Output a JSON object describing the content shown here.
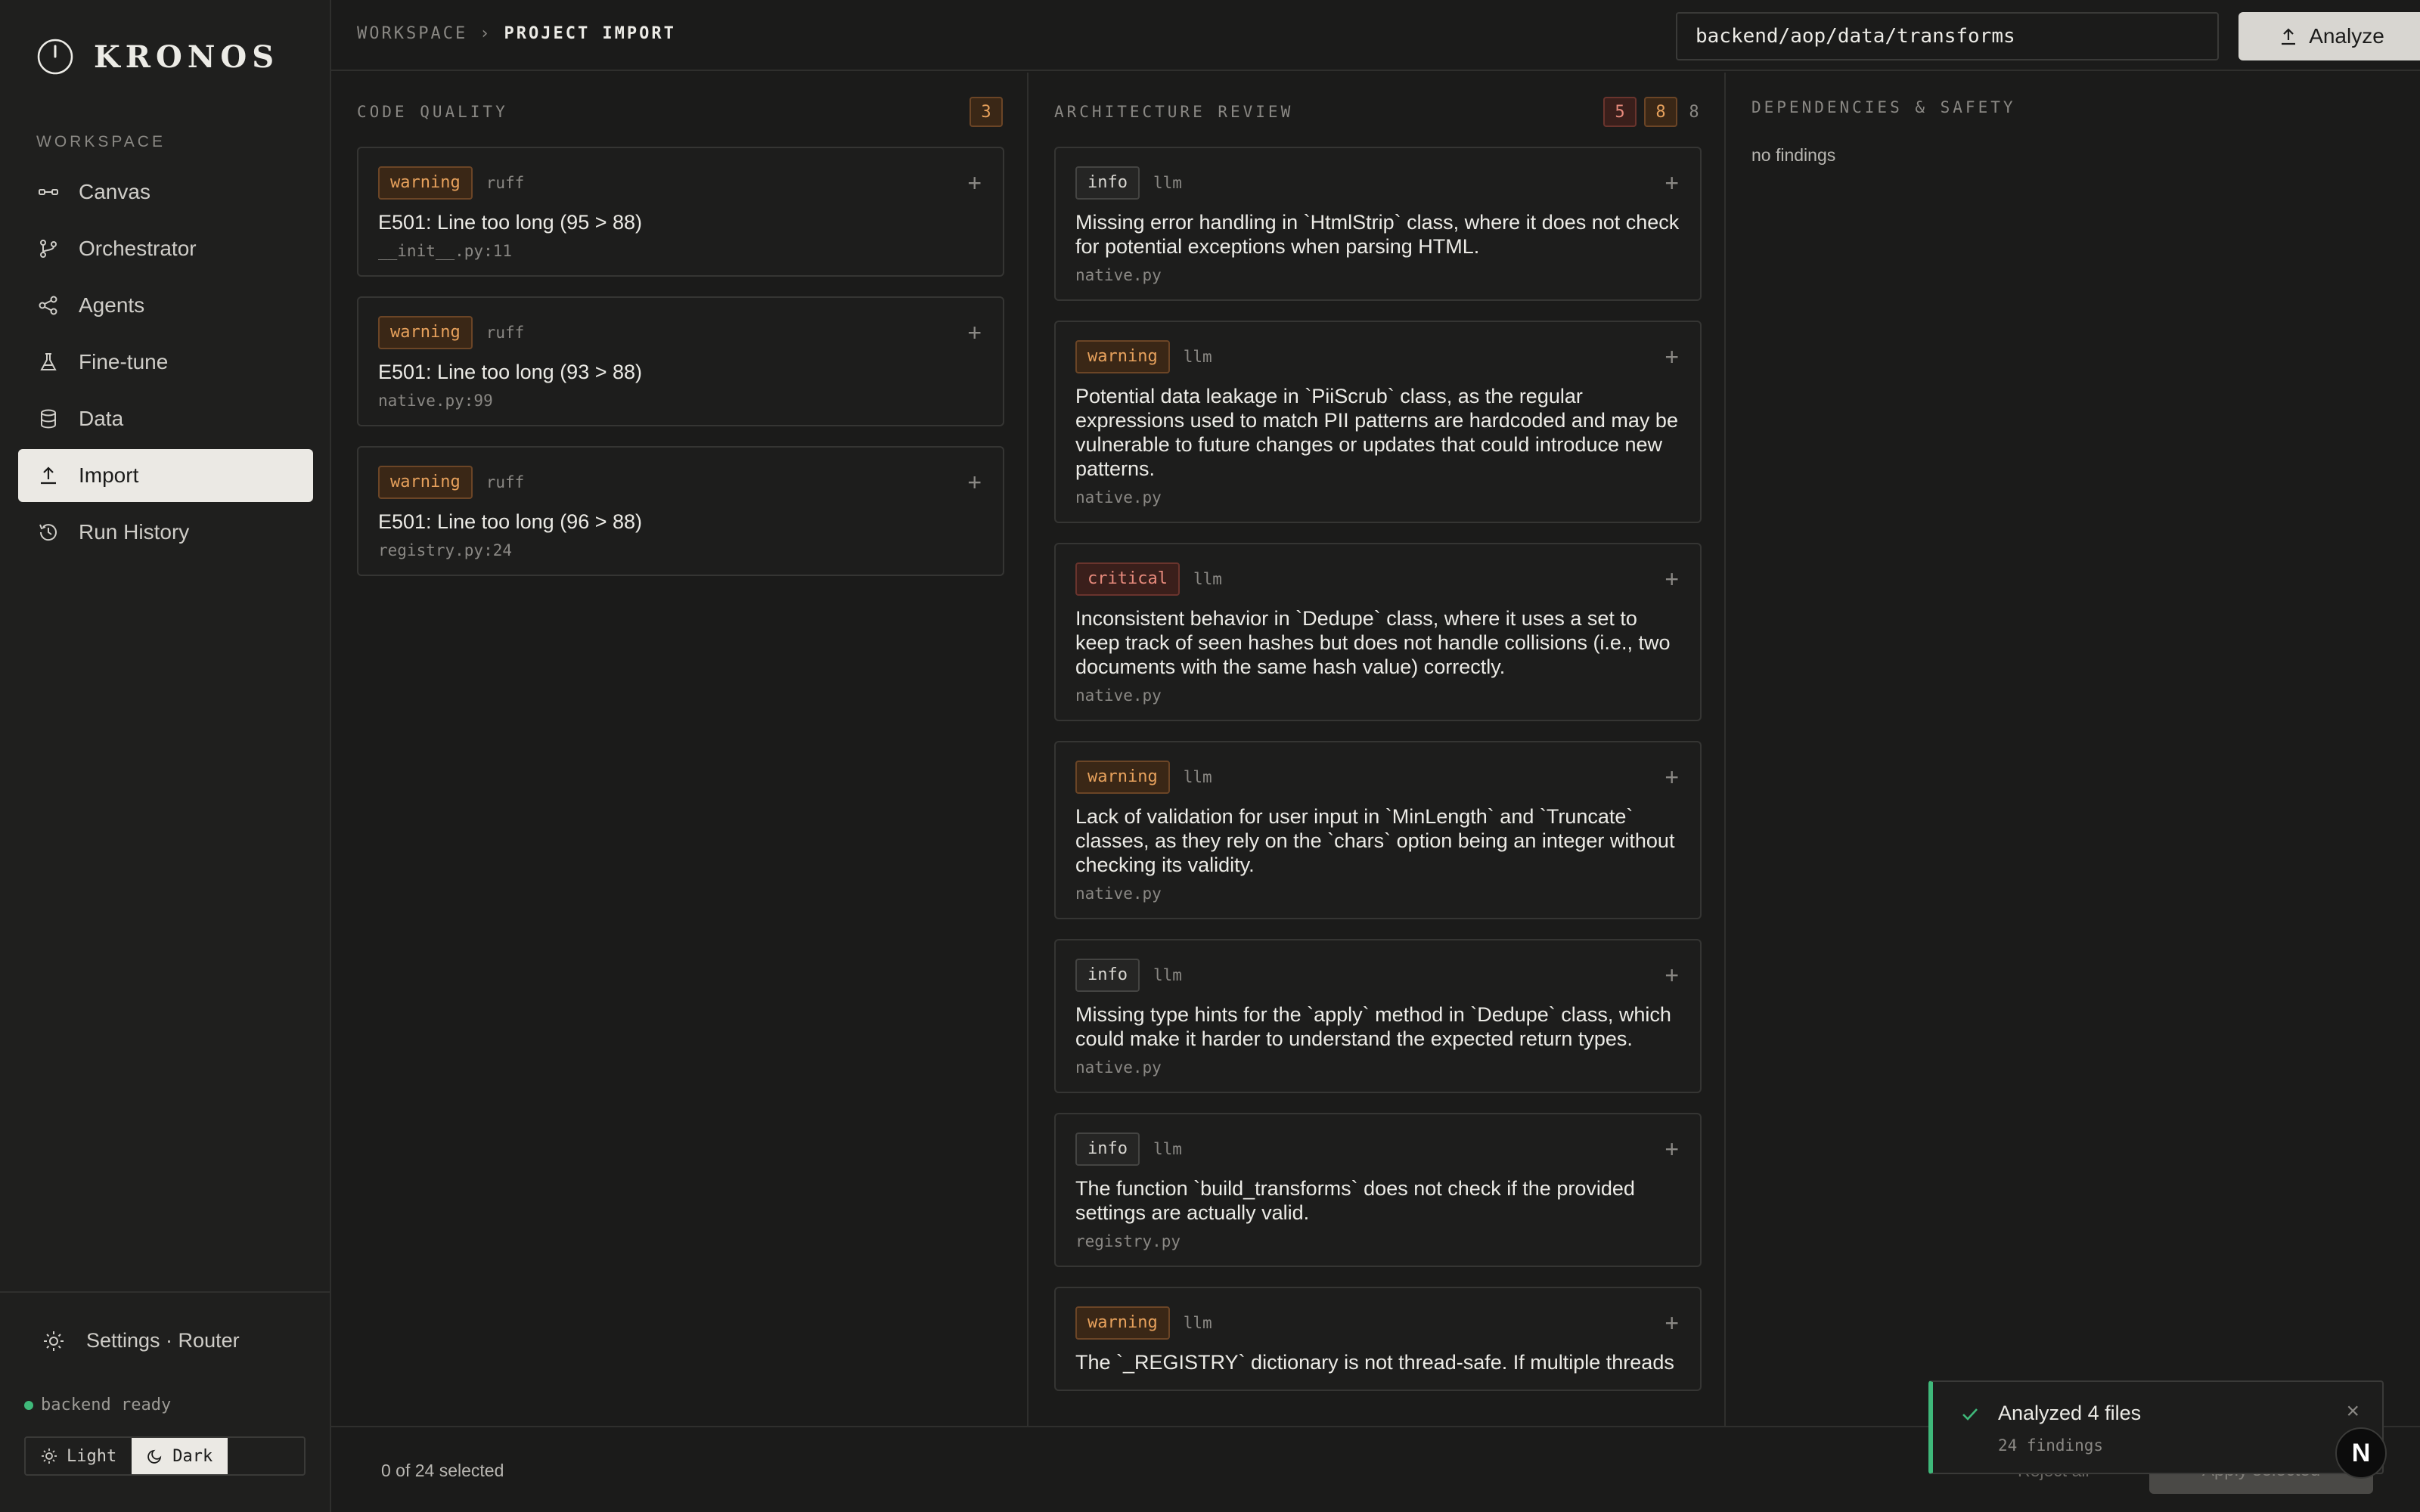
{
  "app": {
    "name": "KRONOS"
  },
  "sidebar": {
    "section_label": "WORKSPACE",
    "items": [
      {
        "label": "Canvas",
        "icon": "canvas-icon"
      },
      {
        "label": "Orchestrator",
        "icon": "branch-icon"
      },
      {
        "label": "Agents",
        "icon": "agents-icon"
      },
      {
        "label": "Fine-tune",
        "icon": "flask-icon"
      },
      {
        "label": "Data",
        "icon": "database-icon"
      },
      {
        "label": "Import",
        "icon": "upload-icon",
        "active": true
      },
      {
        "label": "Run History",
        "icon": "history-icon"
      }
    ],
    "settings_label": "Settings · Router",
    "status_text": "backend ready",
    "theme": {
      "light": "Light",
      "dark": "Dark",
      "selected": "Dark"
    }
  },
  "topbar": {
    "breadcrumb": [
      "WORKSPACE",
      "PROJECT IMPORT"
    ],
    "breadcrumb_sep": "›",
    "path_value": "backend/aop/data/transforms",
    "analyze_label": "Analyze"
  },
  "columns": {
    "code_quality": {
      "title": "CODE QUALITY",
      "counts": [
        {
          "value": "3",
          "tone": "warning"
        }
      ],
      "findings": [
        {
          "severity": "warning",
          "source": "ruff",
          "message": "E501: Line too long (95 > 88)",
          "location": "__init__.py:11"
        },
        {
          "severity": "warning",
          "source": "ruff",
          "message": "E501: Line too long (93 > 88)",
          "location": "native.py:99"
        },
        {
          "severity": "warning",
          "source": "ruff",
          "message": "E501: Line too long (96 > 88)",
          "location": "registry.py:24"
        }
      ]
    },
    "architecture": {
      "title": "ARCHITECTURE REVIEW",
      "counts": [
        {
          "value": "5",
          "tone": "critical"
        },
        {
          "value": "8",
          "tone": "warning"
        },
        {
          "value": "8",
          "tone": "plain"
        }
      ],
      "findings": [
        {
          "severity": "info",
          "source": "llm",
          "message": "Missing error handling in `HtmlStrip` class, where it does not check for potential exceptions when parsing HTML.",
          "location": "native.py"
        },
        {
          "severity": "warning",
          "source": "llm",
          "message": "Potential data leakage in `PiiScrub` class, as the regular expressions used to match PII patterns are hardcoded and may be vulnerable to future changes or updates that could introduce new patterns.",
          "location": "native.py"
        },
        {
          "severity": "critical",
          "source": "llm",
          "message": "Inconsistent behavior in `Dedupe` class, where it uses a set to keep track of seen hashes but does not handle collisions (i.e., two documents with the same hash value) correctly.",
          "location": "native.py"
        },
        {
          "severity": "warning",
          "source": "llm",
          "message": "Lack of validation for user input in `MinLength` and `Truncate` classes, as they rely on the `chars` option being an integer without checking its validity.",
          "location": "native.py"
        },
        {
          "severity": "info",
          "source": "llm",
          "message": "Missing type hints for the `apply` method in `Dedupe` class, which could make it harder to understand the expected return types.",
          "location": "native.py"
        },
        {
          "severity": "info",
          "source": "llm",
          "message": "The function `build_transforms` does not check if the provided settings are actually valid.",
          "location": "registry.py"
        },
        {
          "severity": "warning",
          "source": "llm",
          "message": "The `_REGISTRY` dictionary is not thread-safe. If multiple threads",
          "location": ""
        }
      ]
    },
    "dependencies": {
      "title": "DEPENDENCIES & SAFETY",
      "empty_text": "no findings"
    }
  },
  "footer": {
    "selected_text": "0 of 24 selected",
    "secondary_action": "Reject all",
    "primary_action": "Apply selected"
  },
  "toast": {
    "title": "Analyzed 4 files",
    "subtitle": "24 findings",
    "close": "×"
  },
  "avatar": {
    "initial": "N"
  },
  "colors": {
    "background": "#1b1b1a",
    "warning": "#e7a15c",
    "critical": "#e78a7c",
    "success": "#3fb97a",
    "active_nav": "#ebe9e4"
  }
}
